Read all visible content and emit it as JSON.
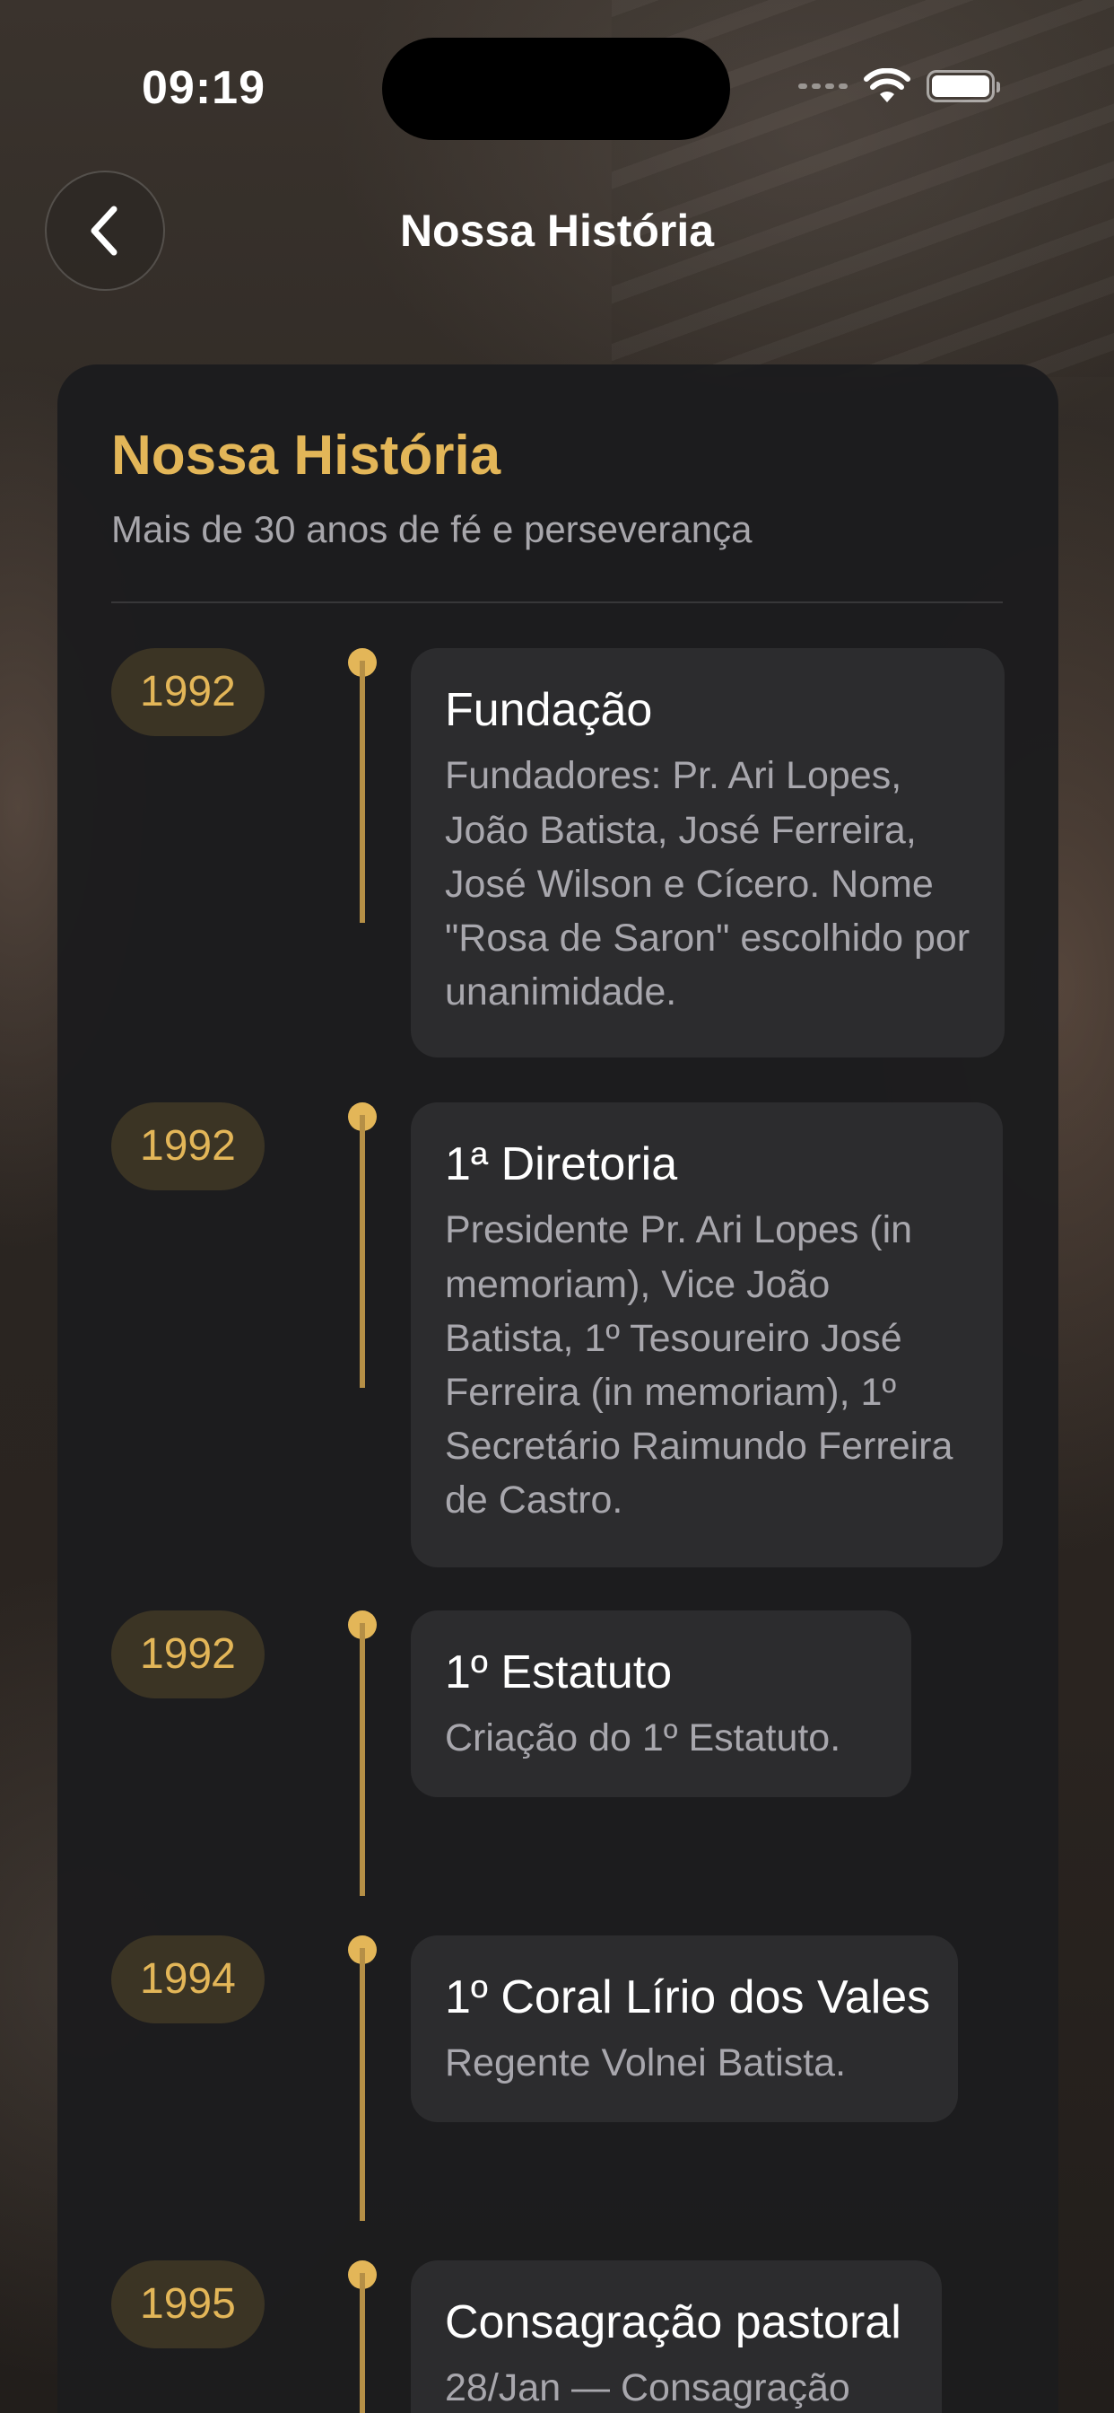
{
  "status_bar": {
    "time": "09:19"
  },
  "nav": {
    "title": "Nossa História",
    "back_icon": "chevron-left-icon"
  },
  "card": {
    "title": "Nossa História",
    "subtitle": "Mais de 30 anos de fé e perseverança"
  },
  "colors": {
    "accent": "#e3b658",
    "background": "#1c1c1e",
    "event_box": "#2c2c2e",
    "pill_background": "#3b3424"
  },
  "timeline": [
    {
      "year": "1992",
      "title": "Fundação",
      "description": "Fundadores: Pr. Ari Lopes, João Batista, José Ferreira, José Wilson e Cícero. Nome \"Rosa de Saron\" escolhido por unanimidade."
    },
    {
      "year": "1992",
      "title": "1ª Diretoria",
      "description": "Presidente Pr. Ari Lopes (in memoriam), Vice João Batista, 1º Tesoureiro José Ferreira (in memoriam), 1º Secretário Raimundo Ferreira de Castro."
    },
    {
      "year": "1992",
      "title": "1º Estatuto",
      "description": "Criação do 1º Estatuto."
    },
    {
      "year": "1994",
      "title": "1º Coral Lírio dos Vales",
      "description": "Regente Volnei Batista."
    },
    {
      "year": "1995",
      "title": "Consagração pastoral",
      "description": "28/Jan — Consagração"
    }
  ]
}
